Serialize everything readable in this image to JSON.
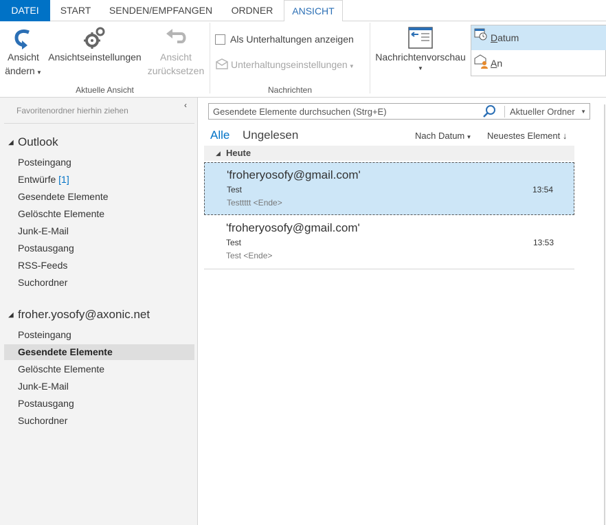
{
  "ribbon_tabs": {
    "file": "DATEI",
    "start": "START",
    "send_receive": "SENDEN/EMPFANGEN",
    "folder": "ORDNER",
    "view": "ANSICHT"
  },
  "ribbon": {
    "change_view": [
      "Ansicht",
      "ändern"
    ],
    "view_settings": "Ansichtseinstellungen",
    "reset_view": [
      "Ansicht",
      "zurücksetzen"
    ],
    "group_current_view": "Aktuelle Ansicht",
    "show_conversations": "Als Unterhaltungen anzeigen",
    "conversation_settings": "Unterhaltungseinstellungen",
    "group_messages": "Nachrichten",
    "message_preview": "Nachrichtenvorschau",
    "arrangement": {
      "date_prefix": "D",
      "date_rest": "atum",
      "to_prefix": "A",
      "to_rest": "n"
    }
  },
  "nav": {
    "favorites_hint": "Favoritenordner hierhin ziehen",
    "collapse": "‹",
    "accounts": [
      {
        "name": "Outlook",
        "folders": [
          {
            "label": "Posteingang"
          },
          {
            "label": "Entwürfe",
            "badge": "[1]"
          },
          {
            "label": "Gesendete Elemente"
          },
          {
            "label": "Gelöschte Elemente"
          },
          {
            "label": "Junk-E-Mail"
          },
          {
            "label": "Postausgang"
          },
          {
            "label": "RSS-Feeds"
          },
          {
            "label": "Suchordner"
          }
        ]
      },
      {
        "name": "froher.yosofy@axonic.net",
        "folders": [
          {
            "label": "Posteingang"
          },
          {
            "label": "Gesendete Elemente",
            "selected": true
          },
          {
            "label": "Gelöschte Elemente"
          },
          {
            "label": "Junk-E-Mail"
          },
          {
            "label": "Postausgang"
          },
          {
            "label": "Suchordner"
          }
        ]
      }
    ]
  },
  "search": {
    "placeholder": "Gesendete Elemente durchsuchen (Strg+E)",
    "scope": "Aktueller Ordner"
  },
  "list": {
    "filter_all": "Alle",
    "filter_unread": "Ungelesen",
    "sort_by": "Nach Datum",
    "sort_order": "Neuestes Element",
    "group": "Heute",
    "messages": [
      {
        "from": "'froheryosofy@gmail.com'",
        "subject": "Test",
        "time": "13:54",
        "preview": "Testtttt <Ende>",
        "selected": true
      },
      {
        "from": "'froheryosofy@gmail.com'",
        "subject": "Test",
        "time": "13:53",
        "preview": "Test <Ende>",
        "selected": false
      }
    ]
  },
  "colors": {
    "accent": "#0072c6",
    "selection": "#cde6f7",
    "active_tab_text": "#2b6fb5"
  }
}
